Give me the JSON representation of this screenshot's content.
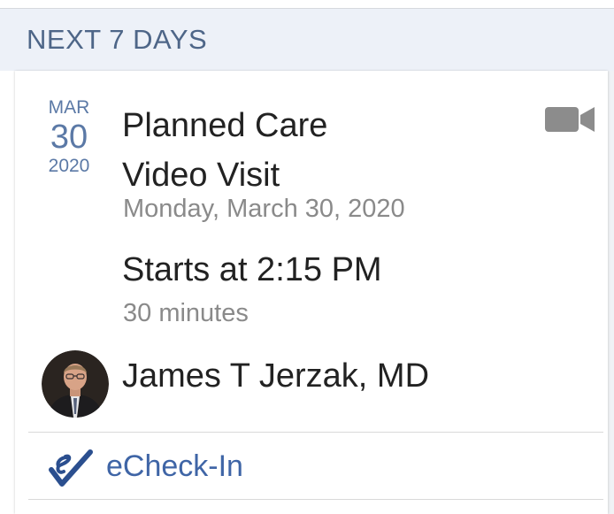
{
  "section": {
    "title": "NEXT 7 DAYS"
  },
  "appointment": {
    "month": "MAR",
    "day": "30",
    "year": "2020",
    "title_line1": "Planned Care",
    "title_line2": "Video Visit",
    "full_date": "Monday, March 30, 2020",
    "start_time": "Starts at 2:15 PM",
    "duration": "30 minutes",
    "type_icon": "video-camera-icon"
  },
  "provider": {
    "name": "James T Jerzak, MD"
  },
  "action": {
    "label": "eCheck-In",
    "icon": "echeckin-icon"
  },
  "colors": {
    "header_bg": "#edf1f8",
    "header_text": "#4e6688",
    "date_accent": "#5b79a6",
    "link": "#3f65a6",
    "icon_gray": "#8c8c8c"
  }
}
